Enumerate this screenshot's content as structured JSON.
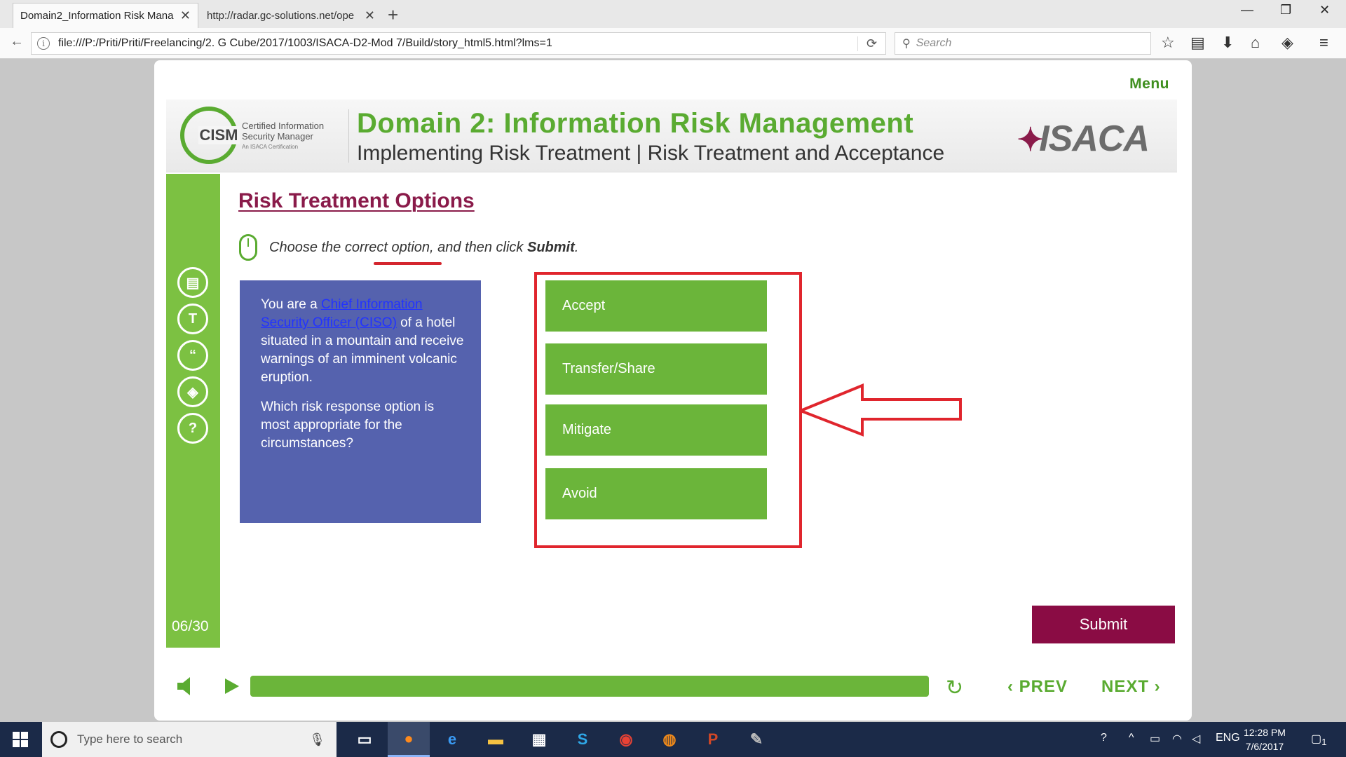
{
  "browser": {
    "tabs": [
      {
        "label": "Domain2_Information Risk Mana",
        "active": true
      },
      {
        "label": "http://radar.gc-solutions.net/ope",
        "active": false
      }
    ],
    "url": "file:///P:/Priti/Priti/Freelancing/2. G Cube/2017/1003/ISACA-D2-Mod 7/Build/story_html5.html?lms=1",
    "search_placeholder": "Search"
  },
  "course": {
    "menu_label": "Menu",
    "cism_logo_text": "CISM",
    "cism_sub_line1": "Certified Information",
    "cism_sub_line2": "Security Manager",
    "cism_sub_line3": "An ISACA Certification",
    "domain_title": "Domain 2: Information Risk Management",
    "topic_title": "Implementing Risk Treatment | Risk Treatment and Acceptance",
    "isaca_logo": "ISACA",
    "slide_counter": "06/30",
    "slide_title": "Risk Treatment Options",
    "instruction_prefix": "Choose the correct option, and then click ",
    "instruction_bold": "Submit",
    "instruction_suffix": ".",
    "question": {
      "intro": "You are a ",
      "link_text": "Chief Information Security Officer (CISO)",
      "rest": " of a hotel situated in a mountain and receive warnings of an imminent volcanic eruption.",
      "prompt": "Which risk response option is most appropriate for the circumstances?"
    },
    "options": [
      "Accept",
      "Transfer/Share",
      "Mitigate",
      "Avoid"
    ],
    "submit_label": "Submit",
    "prev_label": "PREV",
    "next_label": "NEXT",
    "progress": 1.0
  },
  "taskbar": {
    "search_placeholder": "Type here to search",
    "language": "ENG",
    "time": "12:28 PM",
    "date": "7/6/2017",
    "notification_count": "1"
  },
  "colors": {
    "accent_green": "#6bb53a",
    "brand_maroon": "#8a0c44",
    "question_blue": "#5562ae",
    "annotation_red": "#e0252d"
  }
}
